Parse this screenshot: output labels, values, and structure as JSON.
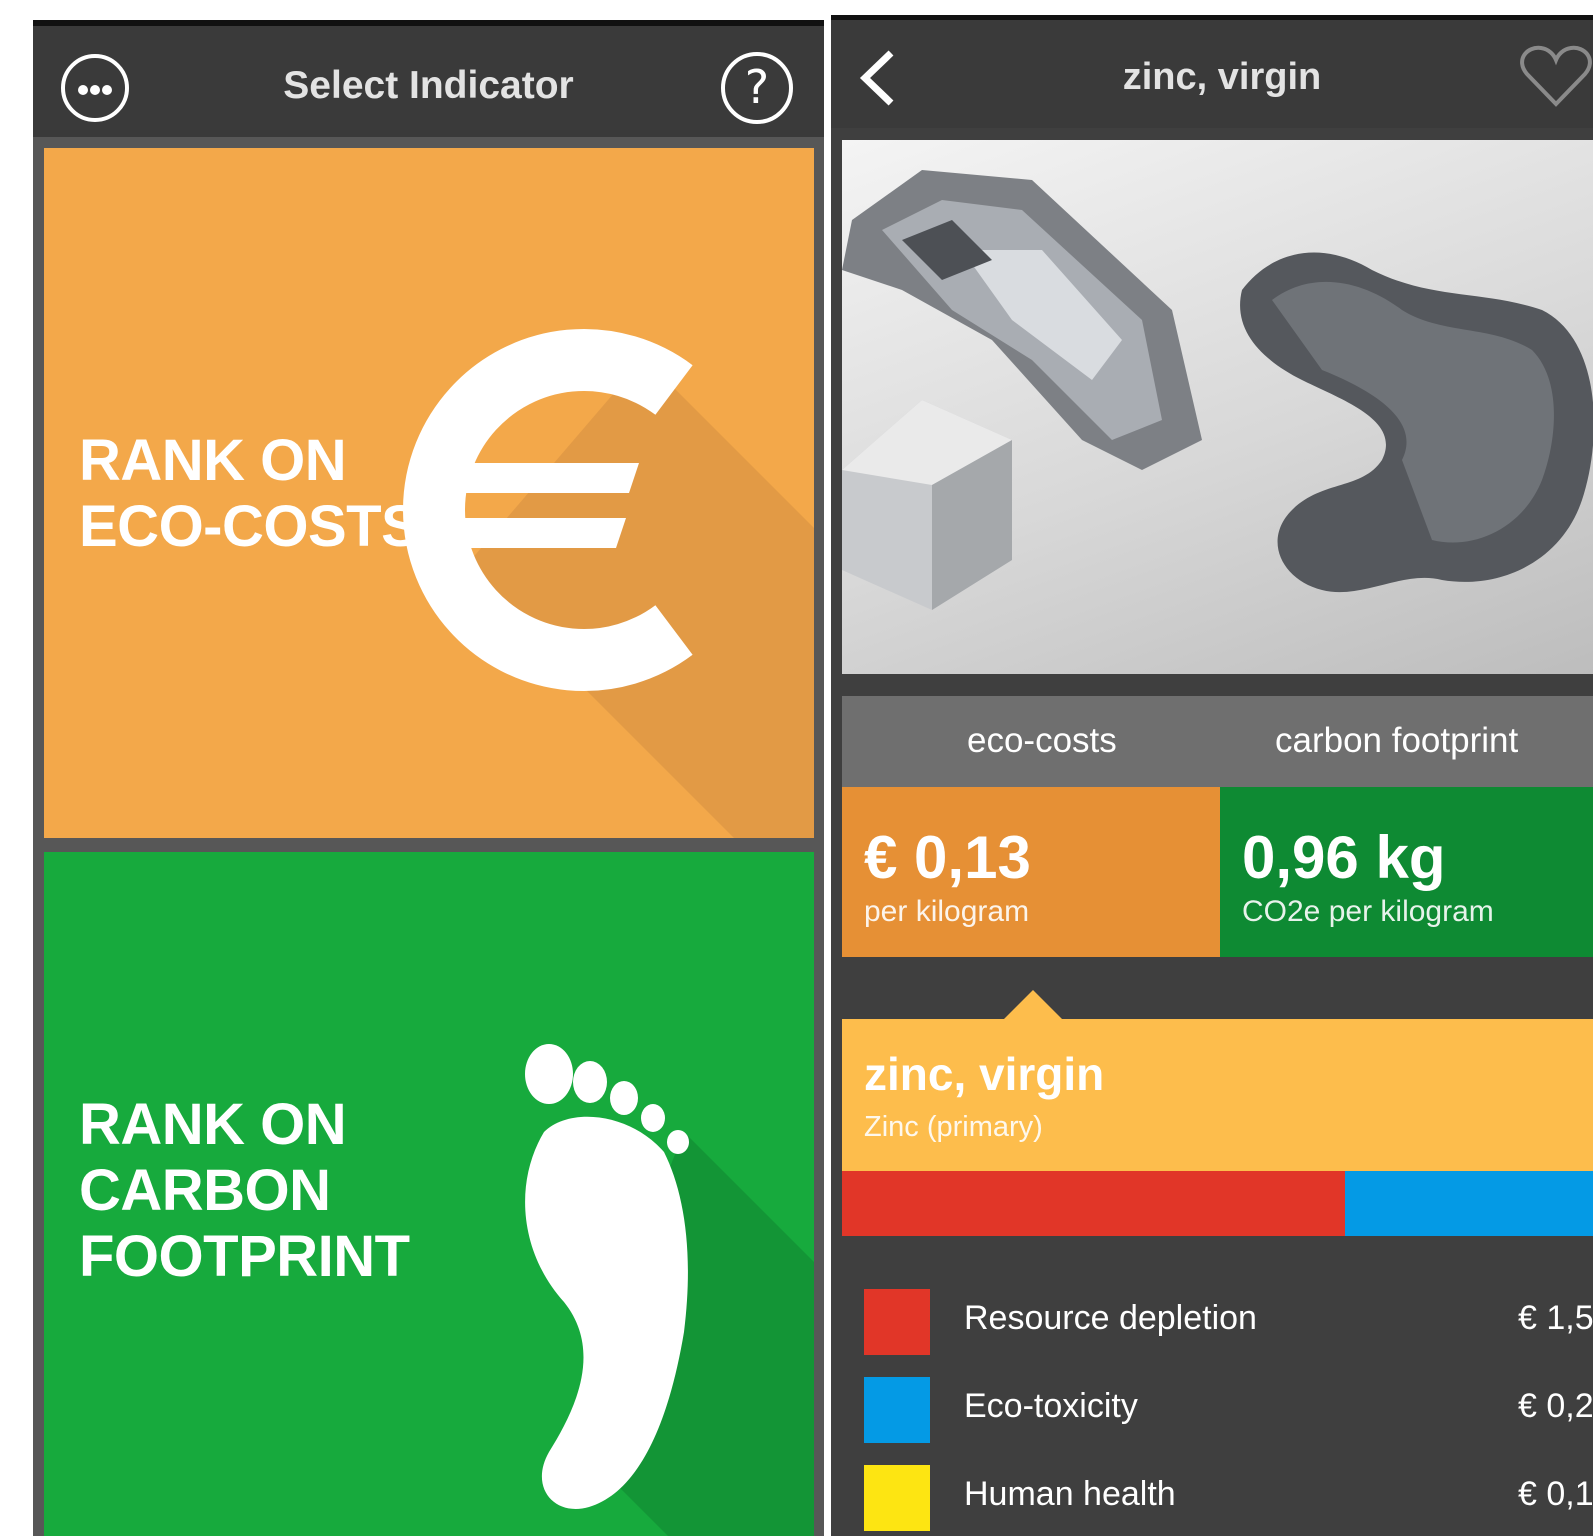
{
  "colors": {
    "eco_orange": "#f3a84a",
    "carbon_green": "#17aa3d",
    "eco_value_orange": "#e69035",
    "carbon_value_green": "#0e8a33",
    "item_yellow": "#fdbd4c",
    "resource_red": "#e13628",
    "toxicity_blue": "#049ae5",
    "health_yellow": "#fde512"
  },
  "left": {
    "menu_icon": "more-dots-icon",
    "title": "Select Indicator",
    "help_icon": "question-icon",
    "help_glyph": "?",
    "tiles": [
      {
        "line1": "RANK ON",
        "line2": "ECO-COSTS",
        "icon": "euro-icon"
      },
      {
        "line1": "RANK ON",
        "line2": "CARBON",
        "line3": "FOOTPRINT",
        "icon": "footprint-icon"
      }
    ]
  },
  "right": {
    "back_icon": "chevron-left-icon",
    "title": "zinc, virgin",
    "favorite_icon": "heart-outline-icon",
    "tabs": [
      "eco-costs",
      "carbon footprint"
    ],
    "eco_value": {
      "value": "€ 0,13",
      "unit": "per kilogram"
    },
    "carbon_value": {
      "value": "0,96 kg",
      "unit": "CO2e per kilogram"
    },
    "item": {
      "name": "zinc, virgin",
      "subtitle": "Zinc (primary)"
    },
    "breakdown_bar": {
      "resource_depletion_fraction": 0.67,
      "eco_toxicity_fraction": 0.33
    },
    "legend": [
      {
        "label": "Resource depletion",
        "value": "€ 1,5"
      },
      {
        "label": "Eco-toxicity",
        "value": "€ 0,2"
      },
      {
        "label": "Human health",
        "value": "€ 0,1"
      }
    ]
  }
}
